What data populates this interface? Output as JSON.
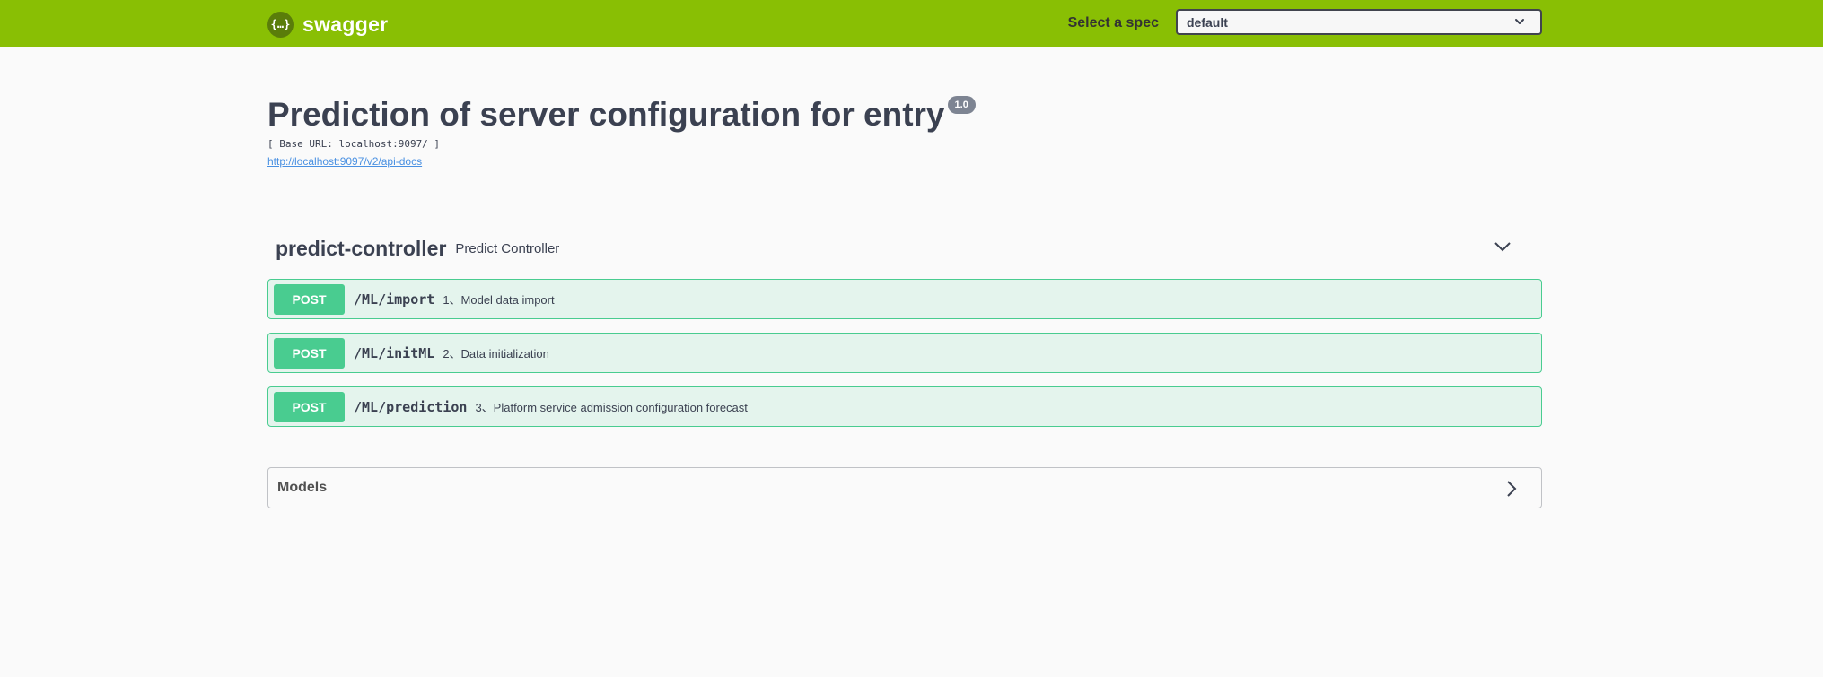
{
  "topbar": {
    "logo_glyph": "{…}",
    "logo_text": "swagger",
    "spec_label": "Select a spec",
    "spec_value": "default",
    "accent": "#89bf04"
  },
  "info": {
    "title": "Prediction of server configuration for entry",
    "version": "1.0",
    "base_url": "[ Base URL: localhost:9097/ ]",
    "docs_link": "http://localhost:9097/v2/api-docs"
  },
  "tag": {
    "name": "predict-controller",
    "description": "Predict Controller",
    "toggle_icon": "chevron-down-icon"
  },
  "operations": [
    {
      "method": "POST",
      "path": "/ML/import",
      "summary": "1、Model data import"
    },
    {
      "method": "POST",
      "path": "/ML/initML",
      "summary": "2、Data initialization"
    },
    {
      "method": "POST",
      "path": "/ML/prediction",
      "summary": "3、Platform service admission configuration forecast"
    }
  ],
  "models": {
    "title": "Models",
    "toggle_icon": "chevron-right-icon"
  },
  "colors": {
    "post": "#49cc90",
    "text": "#3b4151",
    "link": "#4990e2",
    "badge": "#7d8492"
  }
}
